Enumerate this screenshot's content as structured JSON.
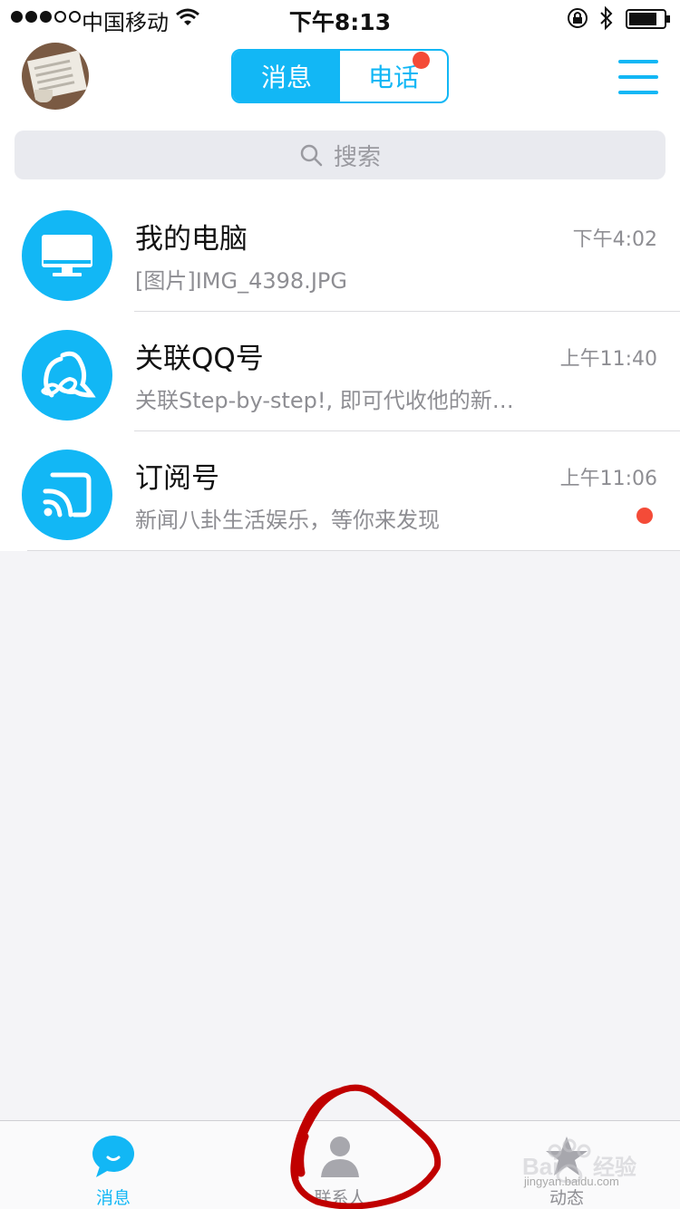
{
  "status_bar": {
    "carrier": "中国移动",
    "time": "下午8:13",
    "signal_bars_filled": 3,
    "signal_bars_total": 5
  },
  "header": {
    "tabs": [
      {
        "label": "消息",
        "active": true
      },
      {
        "label": "电话",
        "active": false,
        "badge": true
      }
    ]
  },
  "search": {
    "placeholder": "搜索"
  },
  "conversations": [
    {
      "title": "我的电脑",
      "preview": "[图片]IMG_4398.JPG",
      "time": "下午4:02",
      "icon": "monitor-icon",
      "unread": false
    },
    {
      "title": "关联QQ号",
      "preview": "关联Step-by-step!, 即可代收他的新…",
      "time": "上午11:40",
      "icon": "linked-accounts-icon",
      "unread": false
    },
    {
      "title": "订阅号",
      "preview": "新闻八卦生活娱乐，等你来发现",
      "time": "上午11:06",
      "icon": "rss-icon",
      "unread": true
    }
  ],
  "tab_bar": {
    "items": [
      {
        "label": "消息",
        "icon": "chat-bubble-icon",
        "active": true
      },
      {
        "label": "联系人",
        "icon": "contact-person-icon",
        "active": false
      },
      {
        "label": "动态",
        "icon": "star-icon",
        "active": false
      }
    ]
  },
  "watermark": {
    "text": "jingyan.baidu.com"
  },
  "colors": {
    "accent": "#12b7f5",
    "badge": "#f44b38",
    "background": "#f4f4f7",
    "annotation": "#c00000"
  }
}
